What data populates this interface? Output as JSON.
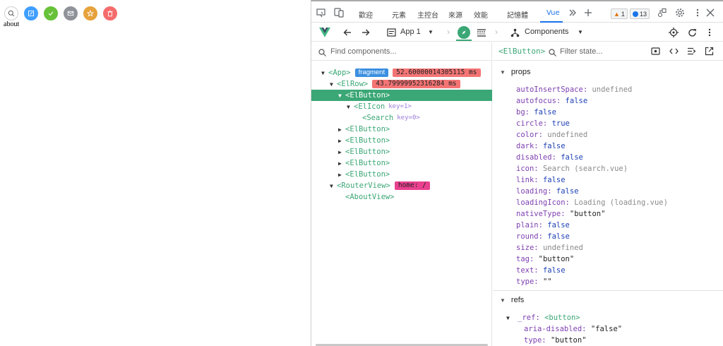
{
  "app": {
    "buttons": [
      {
        "name": "search-icon",
        "bg": "#ffffff",
        "border": "#cfcfcf",
        "color": "#555555"
      },
      {
        "name": "edit-icon",
        "bg": "#409eff",
        "border": "#409eff",
        "color": "#ffffff"
      },
      {
        "name": "check-icon",
        "bg": "#67c23a",
        "border": "#67c23a",
        "color": "#ffffff"
      },
      {
        "name": "message-icon",
        "bg": "#909399",
        "border": "#909399",
        "color": "#ffffff"
      },
      {
        "name": "star-icon",
        "bg": "#e6a23c",
        "border": "#e6a23c",
        "color": "#ffffff"
      },
      {
        "name": "delete-icon",
        "bg": "#f56c6c",
        "border": "#f56c6c",
        "color": "#ffffff"
      }
    ],
    "about_link": "about"
  },
  "devtools": {
    "tabs": [
      "歡迎",
      "元素",
      "主控台",
      "來源",
      "效能",
      "記憶體",
      "Vue"
    ],
    "warnings_count": "1",
    "messages_count": "13"
  },
  "vue_header": {
    "app_select": "App 1",
    "view_select": "Components"
  },
  "tree": {
    "find_placeholder": "Find components...",
    "rows": [
      {
        "label": "<App>",
        "tags": [
          "fragment",
          "52.60000014305115 ms"
        ]
      },
      {
        "label": "<ElRow>",
        "tags": [
          "43.79999952316284 ms"
        ]
      },
      {
        "label": "<ElButton>",
        "selected": true
      },
      {
        "label": "<ElIcon",
        "key": "key=1>"
      },
      {
        "label": "<Search",
        "key": "key=0>"
      },
      {
        "label": "<ElButton>"
      },
      {
        "label": "<ElButton>"
      },
      {
        "label": "<ElButton>"
      },
      {
        "label": "<ElButton>"
      },
      {
        "label": "<ElButton>"
      },
      {
        "label": "<RouterView>",
        "tags": [
          "home: /"
        ]
      },
      {
        "label": "<AboutView>"
      }
    ]
  },
  "inspector": {
    "title": "<ElButton>",
    "filter_placeholder": "Filter state...",
    "props_label": "props",
    "props": [
      {
        "k": "autoInsertSpace:",
        "v": "undefined",
        "t": "muted"
      },
      {
        "k": "autofocus:",
        "v": "false",
        "t": "val"
      },
      {
        "k": "bg:",
        "v": "false",
        "t": "val"
      },
      {
        "k": "circle:",
        "v": "true",
        "t": "val"
      },
      {
        "k": "color:",
        "v": "undefined",
        "t": "muted"
      },
      {
        "k": "dark:",
        "v": "false",
        "t": "val"
      },
      {
        "k": "disabled:",
        "v": "false",
        "t": "val"
      },
      {
        "k": "icon:",
        "v": "Search (search.vue)",
        "t": "muted"
      },
      {
        "k": "link:",
        "v": "false",
        "t": "val"
      },
      {
        "k": "loading:",
        "v": "false",
        "t": "val"
      },
      {
        "k": "loadingIcon:",
        "v": "Loading (loading.vue)",
        "t": "muted"
      },
      {
        "k": "nativeType:",
        "v": "\"button\"",
        "t": "str"
      },
      {
        "k": "plain:",
        "v": "false",
        "t": "val"
      },
      {
        "k": "round:",
        "v": "false",
        "t": "val"
      },
      {
        "k": "size:",
        "v": "undefined",
        "t": "muted"
      },
      {
        "k": "tag:",
        "v": "\"button\"",
        "t": "str"
      },
      {
        "k": "text:",
        "v": "false",
        "t": "val"
      },
      {
        "k": "type:",
        "v": "\"\"",
        "t": "str"
      }
    ],
    "refs_label": "refs",
    "ref_key": "_ref:",
    "ref_value": "<button>",
    "ref_attrs": [
      {
        "k": "aria-disabled:",
        "v": "\"false\""
      },
      {
        "k": "type:",
        "v": "\"button\""
      }
    ]
  }
}
